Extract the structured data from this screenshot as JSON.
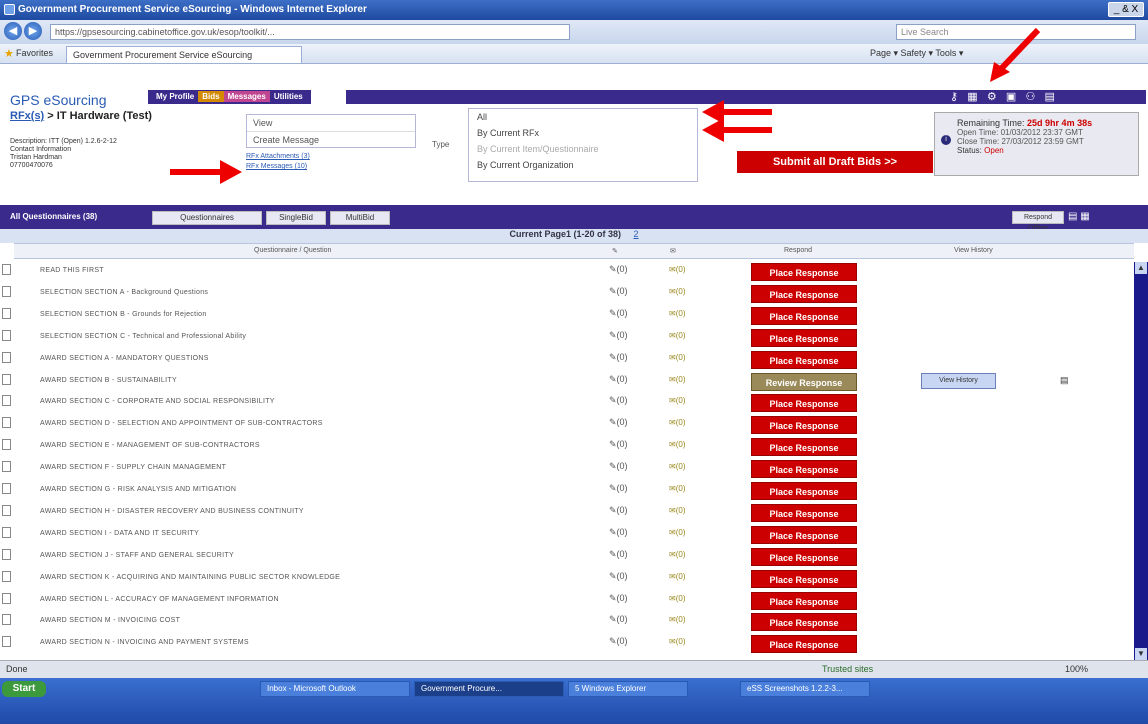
{
  "window": {
    "title": "Government Procurement Service eSourcing - Windows Internet Explorer",
    "controls": "_ & X"
  },
  "browser": {
    "url": "https://gpsesourcing.cabinetoffice.gov.uk/esop/toolkit/...",
    "search_placeholder": "Live Search",
    "favorites": "Favorites",
    "tab": "Government Procurement Service eSourcing",
    "tools": "Page ▾  Safety ▾  Tools ▾"
  },
  "app": {
    "brand": "GPS eSourcing",
    "nav": [
      "My Profile",
      "Bids",
      "Messages",
      "Utilities"
    ],
    "toolbar_icons": [
      "key-icon",
      "grid-icon",
      "gear-icon",
      "calendar-icon",
      "people-icon",
      "document-icon"
    ]
  },
  "breadcrumb": {
    "root": "RFx(s)",
    "sep": " > ",
    "current": "IT Hardware (Test)"
  },
  "description": {
    "line1": "Description: ITT (Open) 1.2.6-2-12",
    "line2": "Contact Information",
    "line3": "Tristan Hardman",
    "line4": "07700470076"
  },
  "links": {
    "attachments": "RFx Attachments (3)",
    "messages": "RFx Messages (10)"
  },
  "menu": {
    "view": "View",
    "create": "Create Message"
  },
  "submenu": {
    "all": "All",
    "by_rfx": "By Current RFx",
    "by_item": "By Current Item/Questionnaire",
    "by_org": "By Current Organization"
  },
  "type_label": "Type",
  "submit_button": "Submit all Draft Bids >>",
  "timer": {
    "remaining_label": "Remaining Time:",
    "remaining_value": "25d 9hr 4m 38s",
    "open_time": "Open Time: 01/03/2012 23:37 GMT",
    "close_time": "Close Time: 27/03/2012 23:59 GMT",
    "status_label": "Status:",
    "status_value": "Open"
  },
  "questionnaires": {
    "title": "All Questionnaires (38)",
    "tabs": [
      "Questionnaires",
      "SingleBid",
      "MultiBid"
    ],
    "offline_button": "Respond Offline"
  },
  "pagination": {
    "label": "Current Page1 (1-20 of 38)",
    "next_page": "2"
  },
  "table": {
    "headers": {
      "name": "Questionnaire / Question",
      "respond": "Respond",
      "history": "View History"
    },
    "rows": [
      {
        "name": "READ THIS FIRST",
        "response": "Place Response"
      },
      {
        "name": "SELECTION SECTION A - Background Questions",
        "response": "Place Response"
      },
      {
        "name": "SELECTION SECTION B - Grounds for Rejection",
        "response": "Place Response"
      },
      {
        "name": "SELECTION SECTION C - Technical and Professional Ability",
        "response": "Place Response"
      },
      {
        "name": "AWARD SECTION A - MANDATORY QUESTIONS",
        "response": "Place Response"
      },
      {
        "name": "AWARD SECTION B - SUSTAINABILITY",
        "response": "Review Response",
        "history": "View History"
      },
      {
        "name": "AWARD SECTION C - CORPORATE AND SOCIAL RESPONSIBILITY",
        "response": "Place Response"
      },
      {
        "name": "AWARD SECTION D - SELECTION AND APPOINTMENT OF SUB-CONTRACTORS",
        "response": "Place Response"
      },
      {
        "name": "AWARD SECTION E - MANAGEMENT OF SUB-CONTRACTORS",
        "response": "Place Response"
      },
      {
        "name": "AWARD SECTION F - SUPPLY CHAIN MANAGEMENT",
        "response": "Place Response"
      },
      {
        "name": "AWARD SECTION G - RISK ANALYSIS AND MITIGATION",
        "response": "Place Response"
      },
      {
        "name": "AWARD SECTION H - DISASTER RECOVERY AND BUSINESS CONTINUITY",
        "response": "Place Response"
      },
      {
        "name": "AWARD SECTION I - DATA AND IT SECURITY",
        "response": "Place Response"
      },
      {
        "name": "AWARD SECTION J - STAFF AND GENERAL SECURITY",
        "response": "Place Response"
      },
      {
        "name": "AWARD SECTION K - ACQUIRING AND MAINTAINING PUBLIC SECTOR KNOWLEDGE",
        "response": "Place Response"
      },
      {
        "name": "AWARD SECTION L - ACCURACY OF MANAGEMENT INFORMATION",
        "response": "Place Response"
      },
      {
        "name": "AWARD SECTION M - INVOICING COST",
        "response": "Place Response"
      },
      {
        "name": "AWARD SECTION N - INVOICING AND PAYMENT SYSTEMS",
        "response": "Place Response"
      }
    ],
    "count_label": "(0)"
  },
  "statusbar": {
    "done": "Done",
    "zone": "Trusted sites",
    "zoom": "100%"
  },
  "taskbar": {
    "start": "Start",
    "tasks": [
      "Inbox - Microsoft Outlook",
      "Government Procure...",
      "5 Windows Explorer",
      "eSS Screenshots 1.2.2-3..."
    ]
  },
  "colors": {
    "brand_purple": "#3a2a8c",
    "response_red": "#cc0000",
    "review_olive": "#9a8a5a"
  }
}
